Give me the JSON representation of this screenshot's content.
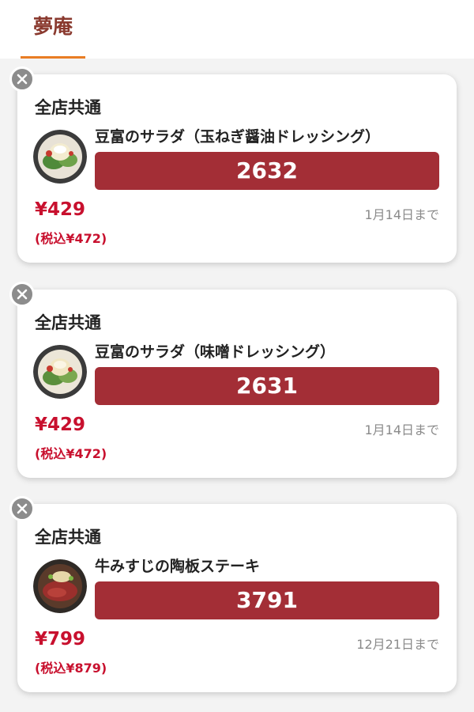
{
  "header": {
    "logo_text": "夢庵"
  },
  "colors": {
    "accent": "#e97d24",
    "code_bar": "#a32e36",
    "price": "#c8102e"
  },
  "coupons": [
    {
      "scope": "全店共通",
      "item_name": "豆富のサラダ（玉ねぎ醤油ドレッシング）",
      "code": "2632",
      "price": "¥429",
      "price_tax": "(税込¥472)",
      "expiry": "1月14日まで",
      "thumb_icon": "salad-icon"
    },
    {
      "scope": "全店共通",
      "item_name": "豆富のサラダ（味噌ドレッシング）",
      "code": "2631",
      "price": "¥429",
      "price_tax": "(税込¥472)",
      "expiry": "1月14日まで",
      "thumb_icon": "salad-icon"
    },
    {
      "scope": "全店共通",
      "item_name": "牛みすじの陶板ステーキ",
      "code": "3791",
      "price": "¥799",
      "price_tax": "(税込¥879)",
      "expiry": "12月21日まで",
      "thumb_icon": "steak-icon"
    }
  ]
}
